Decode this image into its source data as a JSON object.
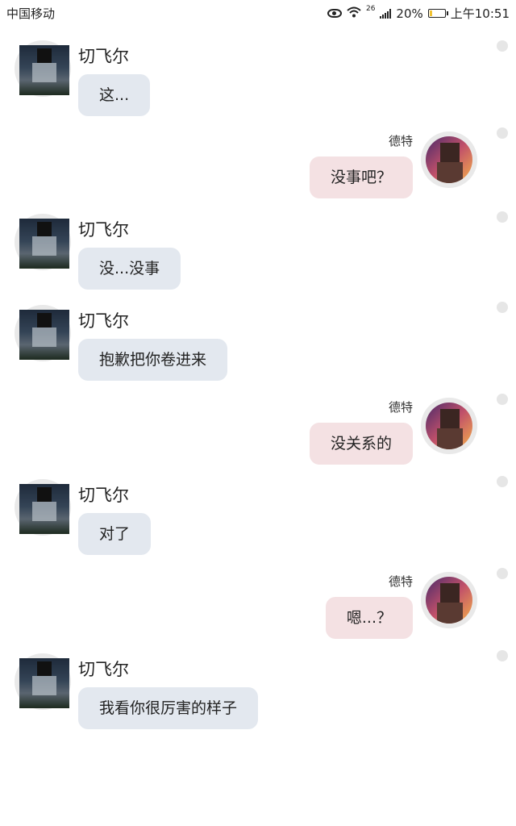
{
  "status_bar": {
    "carrier": "中国移动",
    "network": "26",
    "battery": "20%",
    "battery_level": 0.2,
    "time": "上午10:51"
  },
  "messages": [
    {
      "side": "left",
      "name": "切飞尔",
      "text": "这..."
    },
    {
      "side": "right",
      "name": "德特",
      "text": "没事吧？"
    },
    {
      "side": "left",
      "name": "切飞尔",
      "text": "没...没事"
    },
    {
      "side": "left",
      "name": "切飞尔",
      "text": "抱歉把你卷进来"
    },
    {
      "side": "right",
      "name": "德特",
      "text": "没关系的"
    },
    {
      "side": "left",
      "name": "切飞尔",
      "text": "对了"
    },
    {
      "side": "right",
      "name": "德特",
      "text": "嗯...？"
    },
    {
      "side": "left",
      "name": "切飞尔",
      "text": "我看你很厉害的样子"
    }
  ]
}
